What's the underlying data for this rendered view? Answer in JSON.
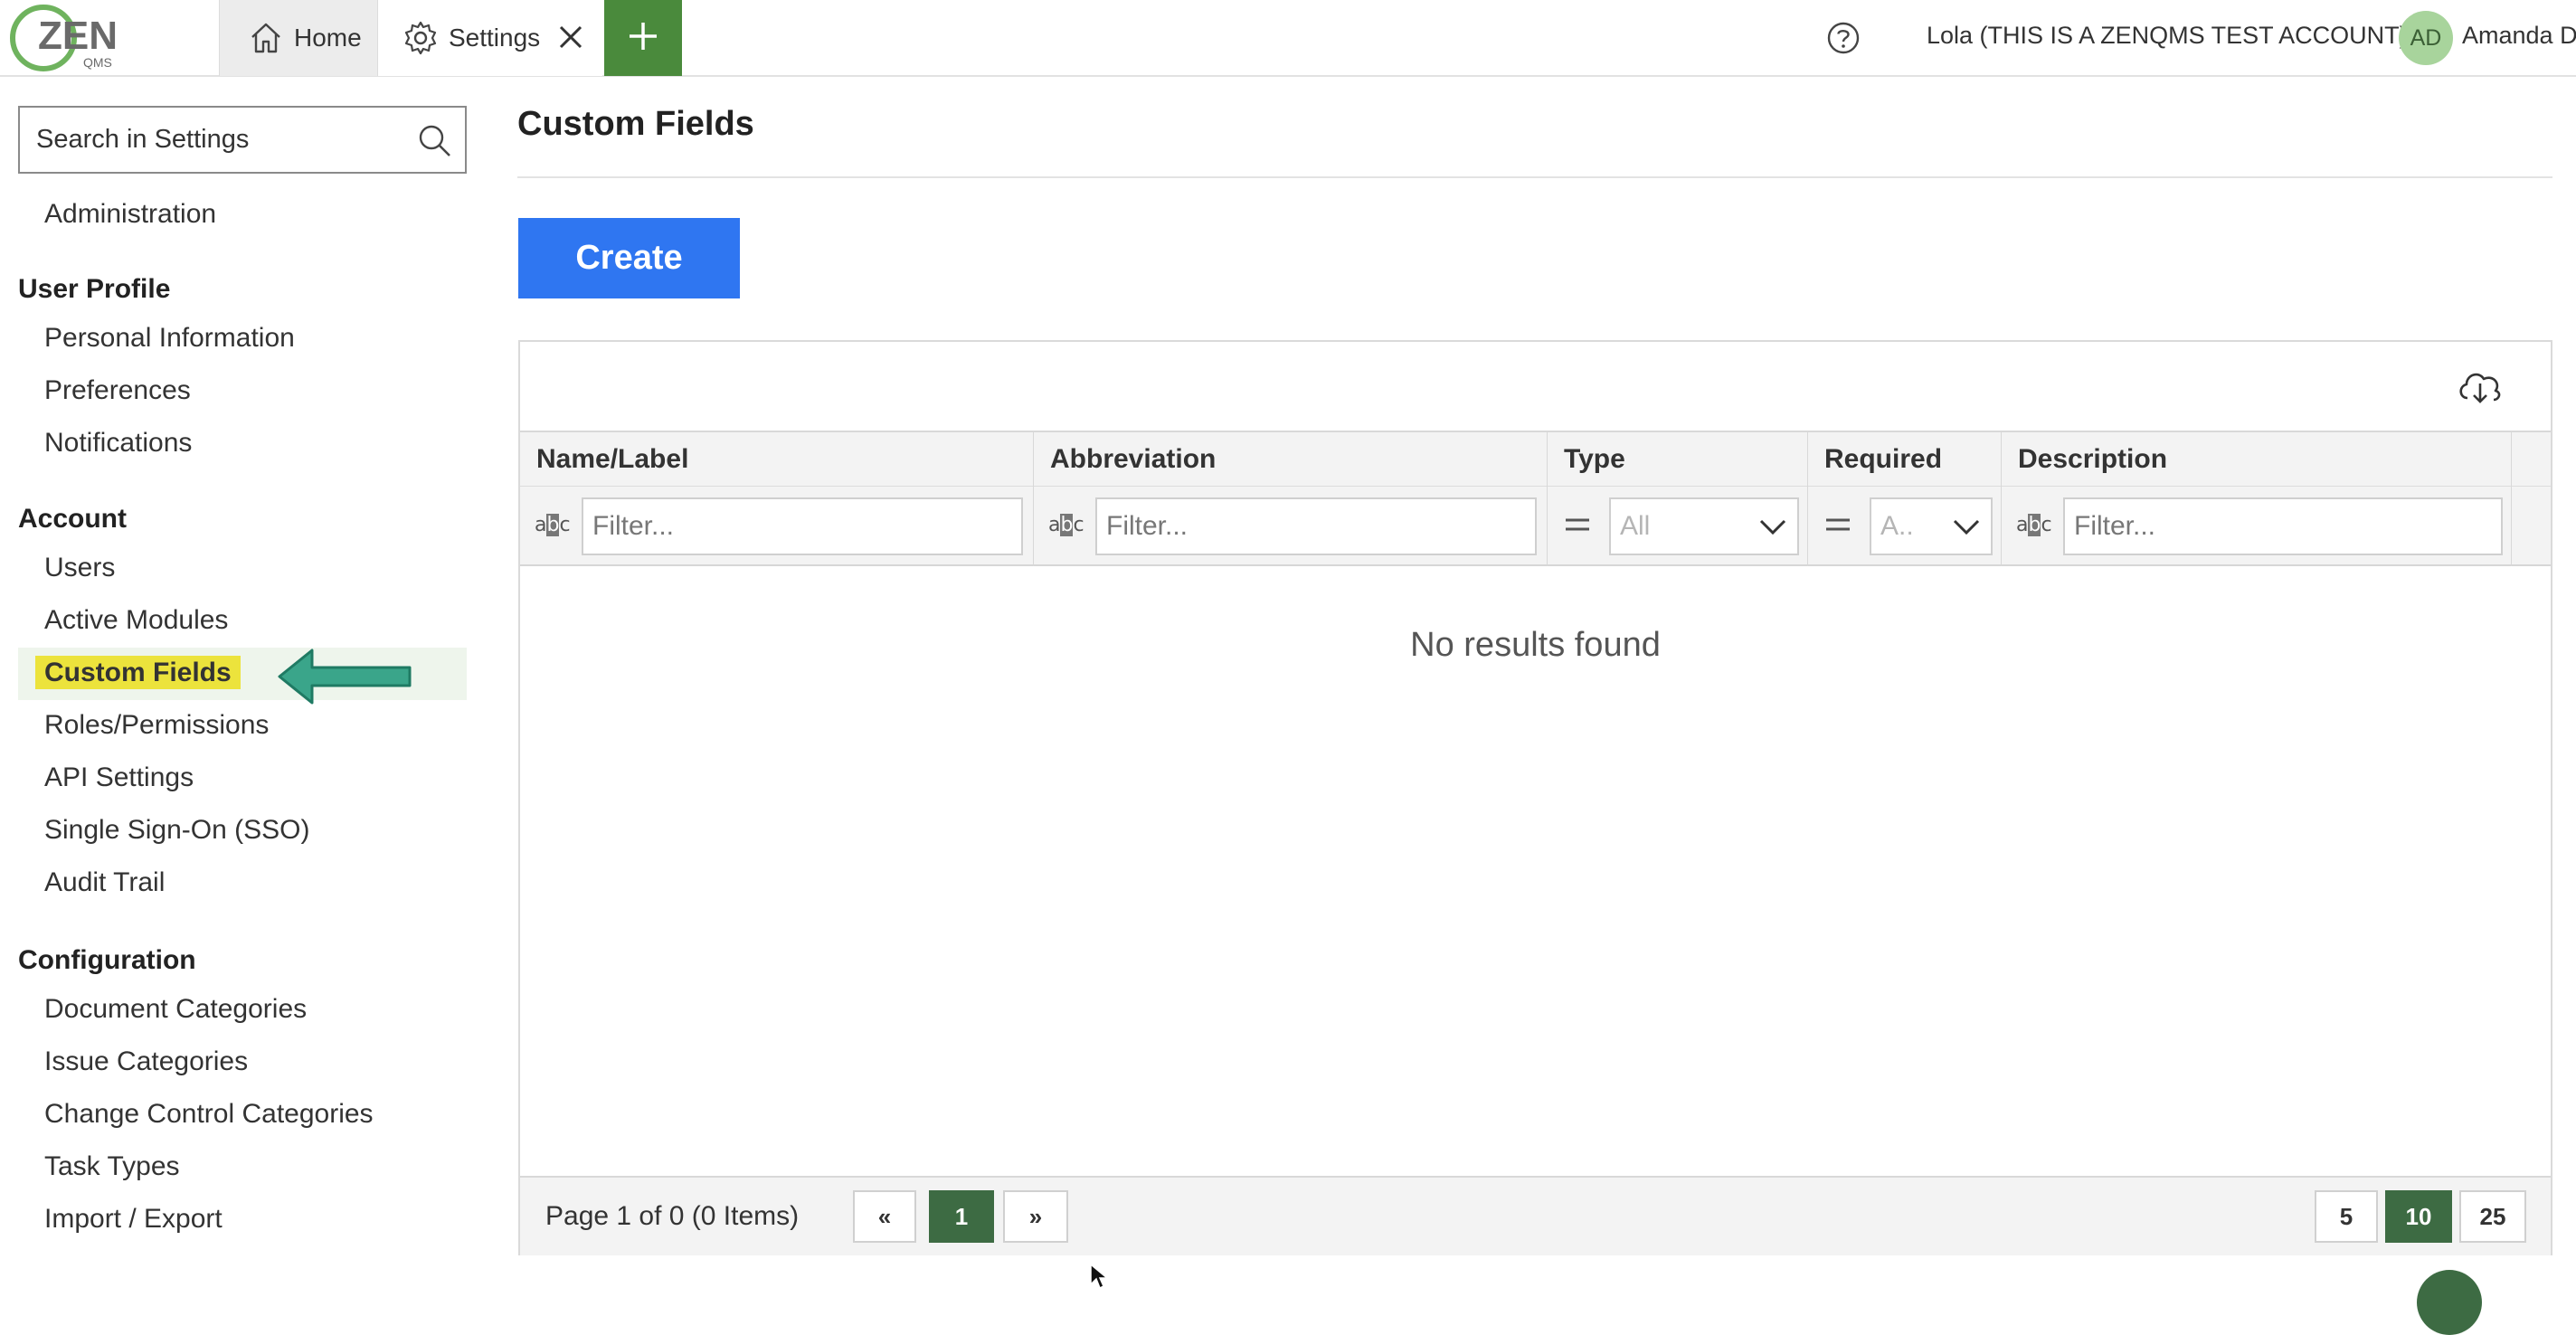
{
  "app": {
    "logo_text": "ZEN",
    "logo_subtext": "QMS",
    "brand_green": "#4a8a3c"
  },
  "topbar": {
    "tabs": [
      {
        "label": "Home",
        "icon": "home-icon"
      },
      {
        "label": "Settings",
        "icon": "gear-icon",
        "closable": true
      }
    ],
    "add_tab_icon": "plus-icon",
    "help_icon": "help-icon",
    "account_name": "Lola (THIS IS A ZENQMS TEST ACCOUNT)",
    "user_initials": "AD",
    "user_name": "Amanda D"
  },
  "sidebar": {
    "search_placeholder": "Search in Settings",
    "administration": "Administration",
    "sections": [
      {
        "title": "User Profile",
        "items": [
          "Personal Information",
          "Preferences",
          "Notifications"
        ]
      },
      {
        "title": "Account",
        "items": [
          "Users",
          "Active Modules",
          "Custom Fields",
          "Roles/Permissions",
          "API Settings",
          "Single Sign-On (SSO)",
          "Audit Trail"
        ]
      },
      {
        "title": "Configuration",
        "items": [
          "Document Categories",
          "Issue Categories",
          "Change Control Categories",
          "Task Types",
          "Import / Export"
        ]
      }
    ],
    "active_item": "Custom Fields",
    "highlight_color": "#ece33c",
    "arrow_color": "#3aa58a"
  },
  "main": {
    "title": "Custom Fields",
    "create_label": "Create",
    "create_color": "#2f76f1",
    "grid": {
      "columns": [
        {
          "label": "Name/Label",
          "filter": "text",
          "filter_placeholder": "Filter..."
        },
        {
          "label": "Abbreviation",
          "filter": "text",
          "filter_placeholder": "Filter..."
        },
        {
          "label": "Type",
          "filter": "select",
          "filter_value": "All"
        },
        {
          "label": "Required",
          "filter": "select",
          "filter_value": "A.."
        },
        {
          "label": "Description",
          "filter": "text",
          "filter_placeholder": "Filter..."
        }
      ],
      "text_filter_icon": "abc-icon",
      "select_filter_icon": "equals-icon",
      "empty_text": "No results found",
      "pager": {
        "info": "Page 1 of 0 (0 Items)",
        "prev": "«",
        "current_page": "1",
        "next": "»",
        "page_sizes": [
          "5",
          "10",
          "25"
        ],
        "active_page_size": "10",
        "active_color": "#3d6b43"
      }
    }
  }
}
